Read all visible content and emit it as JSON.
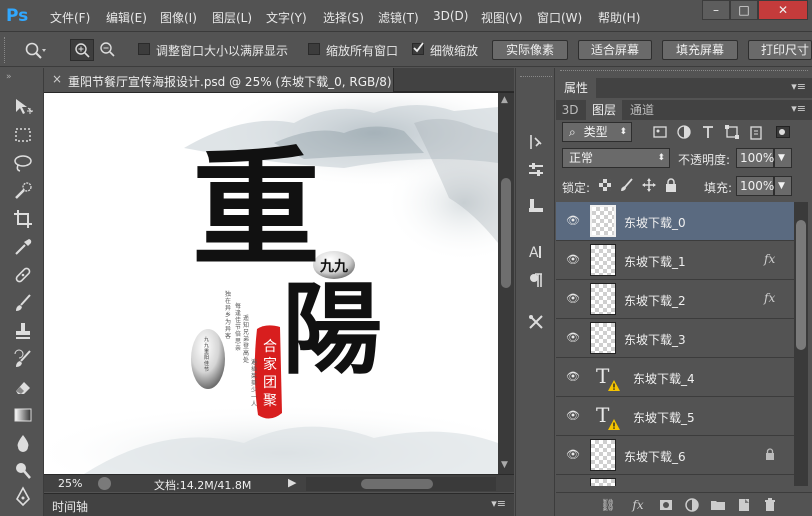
{
  "app": {
    "logo": "Ps"
  },
  "menu": [
    "文件(F)",
    "编辑(E)",
    "图像(I)",
    "图层(L)",
    "文字(Y)",
    "选择(S)",
    "滤镜(T)",
    "3D(D)",
    "视图(V)",
    "窗口(W)",
    "帮助(H)"
  ],
  "window_controls": {
    "minimize": "–",
    "maximize": "□",
    "close": "✕"
  },
  "options": {
    "fit_window_label": "调整窗口大小以满屏显示",
    "zoom_all_label": "缩放所有窗口",
    "scrubby_zoom_label": "细微缩放",
    "scrubby_checked": true,
    "actual_pixels": "实际像素",
    "fit_screen": "适合屏幕",
    "fill_screen": "填充屏幕",
    "print_size": "打印尺寸"
  },
  "document": {
    "tab_title": "重阳节餐厅宣传海报设计.psd @ 25% (东坡下载_0, RGB/8)",
    "close": "×",
    "zoom": "25%",
    "info": "文档:14.2M/41.8M"
  },
  "poster": {
    "big_char_1": "重",
    "big_char_2": "陽",
    "stone_text": "九九",
    "seal_text": "合家团聚",
    "small_col_1": "独在异乡为异客",
    "small_col_2": "每逢佳节倍思亲",
    "small_col_3": "遥知兄弟登高处",
    "small_col_4": "遍插茱萸少一人",
    "pebble_text": "九九重阳佳节"
  },
  "timeline": {
    "label": "时间轴"
  },
  "panels": {
    "properties_tab": "属性",
    "tabs": [
      "3D",
      "图层",
      "通道"
    ],
    "active_tab": "图层",
    "filter_kind": "类型",
    "blend_mode": "正常",
    "opacity_label": "不透明度:",
    "opacity_value": "100%",
    "lock_label": "锁定:",
    "fill_label": "填充:",
    "fill_value": "100%"
  },
  "layers": [
    {
      "name": "东坡下载_0",
      "type": "pixel",
      "selected": true,
      "fx": false,
      "locked": false
    },
    {
      "name": "东坡下载_1",
      "type": "pixel",
      "selected": false,
      "fx": true,
      "locked": false
    },
    {
      "name": "东坡下载_2",
      "type": "pixel",
      "selected": false,
      "fx": true,
      "locked": false
    },
    {
      "name": "东坡下载_3",
      "type": "pixel",
      "selected": false,
      "fx": false,
      "locked": false
    },
    {
      "name": "东坡下载_4",
      "type": "text",
      "selected": false,
      "fx": false,
      "locked": false
    },
    {
      "name": "东坡下载_5",
      "type": "text",
      "selected": false,
      "fx": false,
      "locked": false
    },
    {
      "name": "东坡下载_6",
      "type": "pixel",
      "selected": false,
      "fx": false,
      "locked": true
    }
  ],
  "fx_label": "fx",
  "colors": {
    "accent": "#31a8ff",
    "selection": "#5a6a80",
    "seal_red": "#d81e1e"
  }
}
